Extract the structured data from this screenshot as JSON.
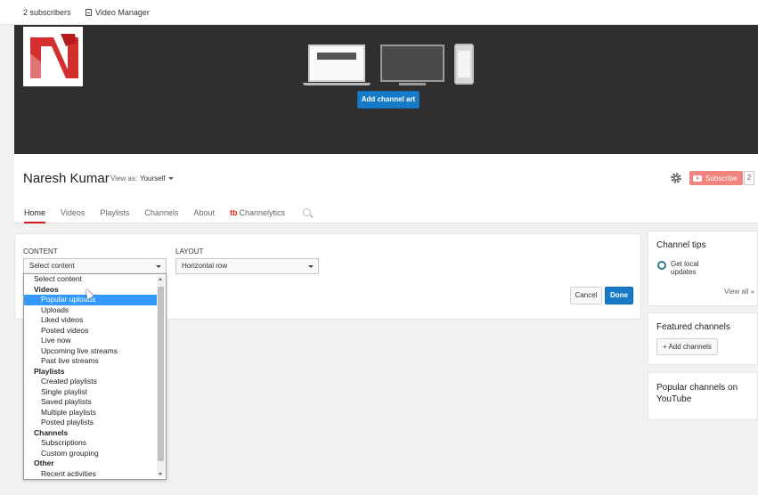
{
  "topbar": {
    "subscribers": "2 subscribers",
    "video_manager": "Video Manager"
  },
  "banner": {
    "add_channel_art": "Add channel art"
  },
  "channel": {
    "name": "Naresh Kumar",
    "view_as_label": "View as:",
    "view_as_value": "Yourself",
    "subscribe_label": "Subscribe",
    "subscriber_count": "2"
  },
  "tabs": [
    "Home",
    "Videos",
    "Playlists",
    "Channels",
    "About",
    "Channelytics"
  ],
  "editor": {
    "content_label": "CONTENT",
    "layout_label": "LAYOUT",
    "content_select": "Select content",
    "layout_select": "Horizontal row",
    "cancel": "Cancel",
    "done": "Done"
  },
  "dropdown": [
    {
      "text": "Select content",
      "kind": "sel"
    },
    {
      "text": "Videos",
      "kind": "group"
    },
    {
      "text": "Popular uploads",
      "kind": "opt",
      "highlight": true
    },
    {
      "text": "Uploads",
      "kind": "opt"
    },
    {
      "text": "Liked videos",
      "kind": "opt"
    },
    {
      "text": "Posted videos",
      "kind": "opt"
    },
    {
      "text": "Live now",
      "kind": "opt"
    },
    {
      "text": "Upcoming live streams",
      "kind": "opt"
    },
    {
      "text": "Past live streams",
      "kind": "opt"
    },
    {
      "text": "Playlists",
      "kind": "group"
    },
    {
      "text": "Created playlists",
      "kind": "opt"
    },
    {
      "text": "Single playlist",
      "kind": "opt"
    },
    {
      "text": "Saved playlists",
      "kind": "opt"
    },
    {
      "text": "Multiple playlists",
      "kind": "opt"
    },
    {
      "text": "Posted playlists",
      "kind": "opt"
    },
    {
      "text": "Channels",
      "kind": "group"
    },
    {
      "text": "Subscriptions",
      "kind": "opt"
    },
    {
      "text": "Custom grouping",
      "kind": "opt"
    },
    {
      "text": "Other",
      "kind": "group"
    },
    {
      "text": "Recent activities",
      "kind": "opt"
    }
  ],
  "sidebar": {
    "tips_title": "Channel tips",
    "tip_text": "Get local updates",
    "view_all": "View all »",
    "featured_title": "Featured channels",
    "add_channels": "+ Add channels",
    "popular_title": "Popular channels on YouTube"
  },
  "colors": {
    "accent_blue": "#167ac6",
    "youtube_red": "#e62117",
    "banner_bg": "#2f2f2f"
  }
}
